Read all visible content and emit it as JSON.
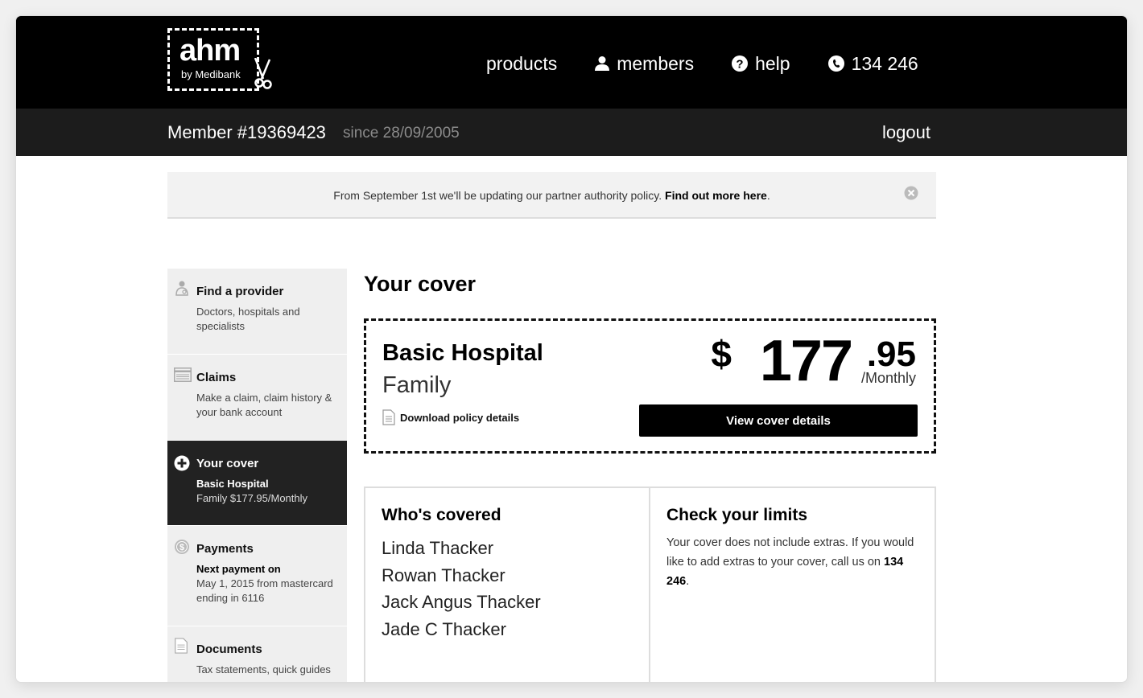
{
  "header": {
    "logo_word": "ahm",
    "logo_sub": "by Medibank",
    "nav": [
      {
        "label": "products",
        "icon": ""
      },
      {
        "label": "members",
        "icon": "user-icon"
      },
      {
        "label": "help",
        "icon": "question-icon"
      },
      {
        "label": "134 246",
        "icon": "phone-icon"
      }
    ]
  },
  "member_bar": {
    "member_id": "Member #19369423",
    "since": "since 28/09/2005",
    "logout": "logout"
  },
  "notice": {
    "text": "From September 1st we'll be updating our partner authority policy.",
    "link": "Find out more here",
    "suffix": "."
  },
  "sidebar": {
    "items": [
      {
        "title": "Find a provider",
        "desc": "Doctors, hospitals and specialists",
        "icon": "doctor-icon"
      },
      {
        "title": "Claims",
        "desc": "Make a claim, claim history & your bank account",
        "icon": "card-icon"
      },
      {
        "title": "Your cover",
        "desc_bold": "Basic Hospital",
        "desc": "Family $177.95/Monthly",
        "icon": "plus-circle-icon",
        "active": true
      },
      {
        "title": "Payments",
        "desc_bold": "Next payment on",
        "desc": "May 1, 2015 from mastercard ending in 6116",
        "icon": "dollar-coin-icon"
      },
      {
        "title": "Documents",
        "desc": "Tax statements, quick guides",
        "icon": "document-icon"
      }
    ]
  },
  "main": {
    "title": "Your cover",
    "cover": {
      "name": "Basic Hospital",
      "type": "Family",
      "download_label": "Download policy details",
      "price_dollar": "$",
      "price_main": "177",
      "price_cents": ".95",
      "price_period": "/Monthly",
      "view_button": "View cover details"
    },
    "covered": {
      "title": "Who's covered",
      "people": [
        "Linda Thacker",
        "Rowan Thacker",
        "Jack Angus Thacker",
        "Jade C Thacker"
      ]
    },
    "limits": {
      "title": "Check your limits",
      "text": "Your cover does not include extras. If you would like to add extras to your cover, call us on",
      "phone": "134 246",
      "suffix": "."
    }
  }
}
